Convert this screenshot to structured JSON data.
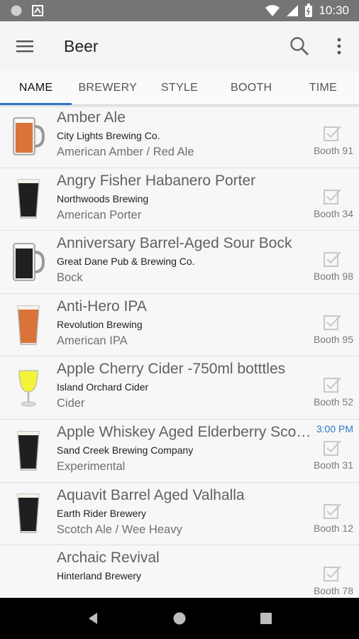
{
  "status": {
    "time": "10:30"
  },
  "app": {
    "title": "Beer"
  },
  "tabs": [
    {
      "label": "NAME",
      "active": true
    },
    {
      "label": "BREWERY",
      "active": false
    },
    {
      "label": "STYLE",
      "active": false
    },
    {
      "label": "BOOTH",
      "active": false
    },
    {
      "label": "TIME",
      "active": false
    }
  ],
  "beers": [
    {
      "name": "Amber Ale",
      "brewery": "City Lights Brewing Co.",
      "style": "American Amber / Red Ale",
      "booth": "Booth 91",
      "time": "",
      "glass": "mug-amber"
    },
    {
      "name": "Angry Fisher Habanero Porter",
      "brewery": "Northwoods Brewing",
      "style": "American Porter",
      "booth": "Booth 34",
      "time": "",
      "glass": "pint-dark"
    },
    {
      "name": "Anniversary Barrel-Aged Sour Bock",
      "brewery": "Great Dane Pub & Brewing Co.",
      "style": "Bock",
      "booth": "Booth 98",
      "time": "",
      "glass": "mug-dark"
    },
    {
      "name": "Anti-Hero IPA",
      "brewery": "Revolution Brewing",
      "style": "American IPA",
      "booth": "Booth 95",
      "time": "",
      "glass": "pint-amber"
    },
    {
      "name": "Apple Cherry Cider -750ml botttles",
      "brewery": "Island Orchard Cider",
      "style": "Cider",
      "booth": "Booth 52",
      "time": "",
      "glass": "wine-yellow"
    },
    {
      "name": "Apple Whiskey Aged Elderberry Scotch Ale",
      "brewery": "Sand Creek Brewing Company",
      "style": "Experimental",
      "booth": "Booth 31",
      "time": "3:00 PM",
      "glass": "pint-dark"
    },
    {
      "name": "Aquavit Barrel Aged Valhalla",
      "brewery": "Earth Rider Brewery",
      "style": "Scotch Ale / Wee Heavy",
      "booth": "Booth 12",
      "time": "",
      "glass": "pint-dark"
    },
    {
      "name": "Archaic Revival",
      "brewery": "Hinterland Brewery",
      "style": "",
      "booth": "Booth 78",
      "time": "",
      "glass": "none"
    }
  ],
  "colors": {
    "accent": "#2f77c9",
    "amber_beer": "#d9733a",
    "dark_beer": "#1f1f1f",
    "cider": "#f3f33a"
  }
}
